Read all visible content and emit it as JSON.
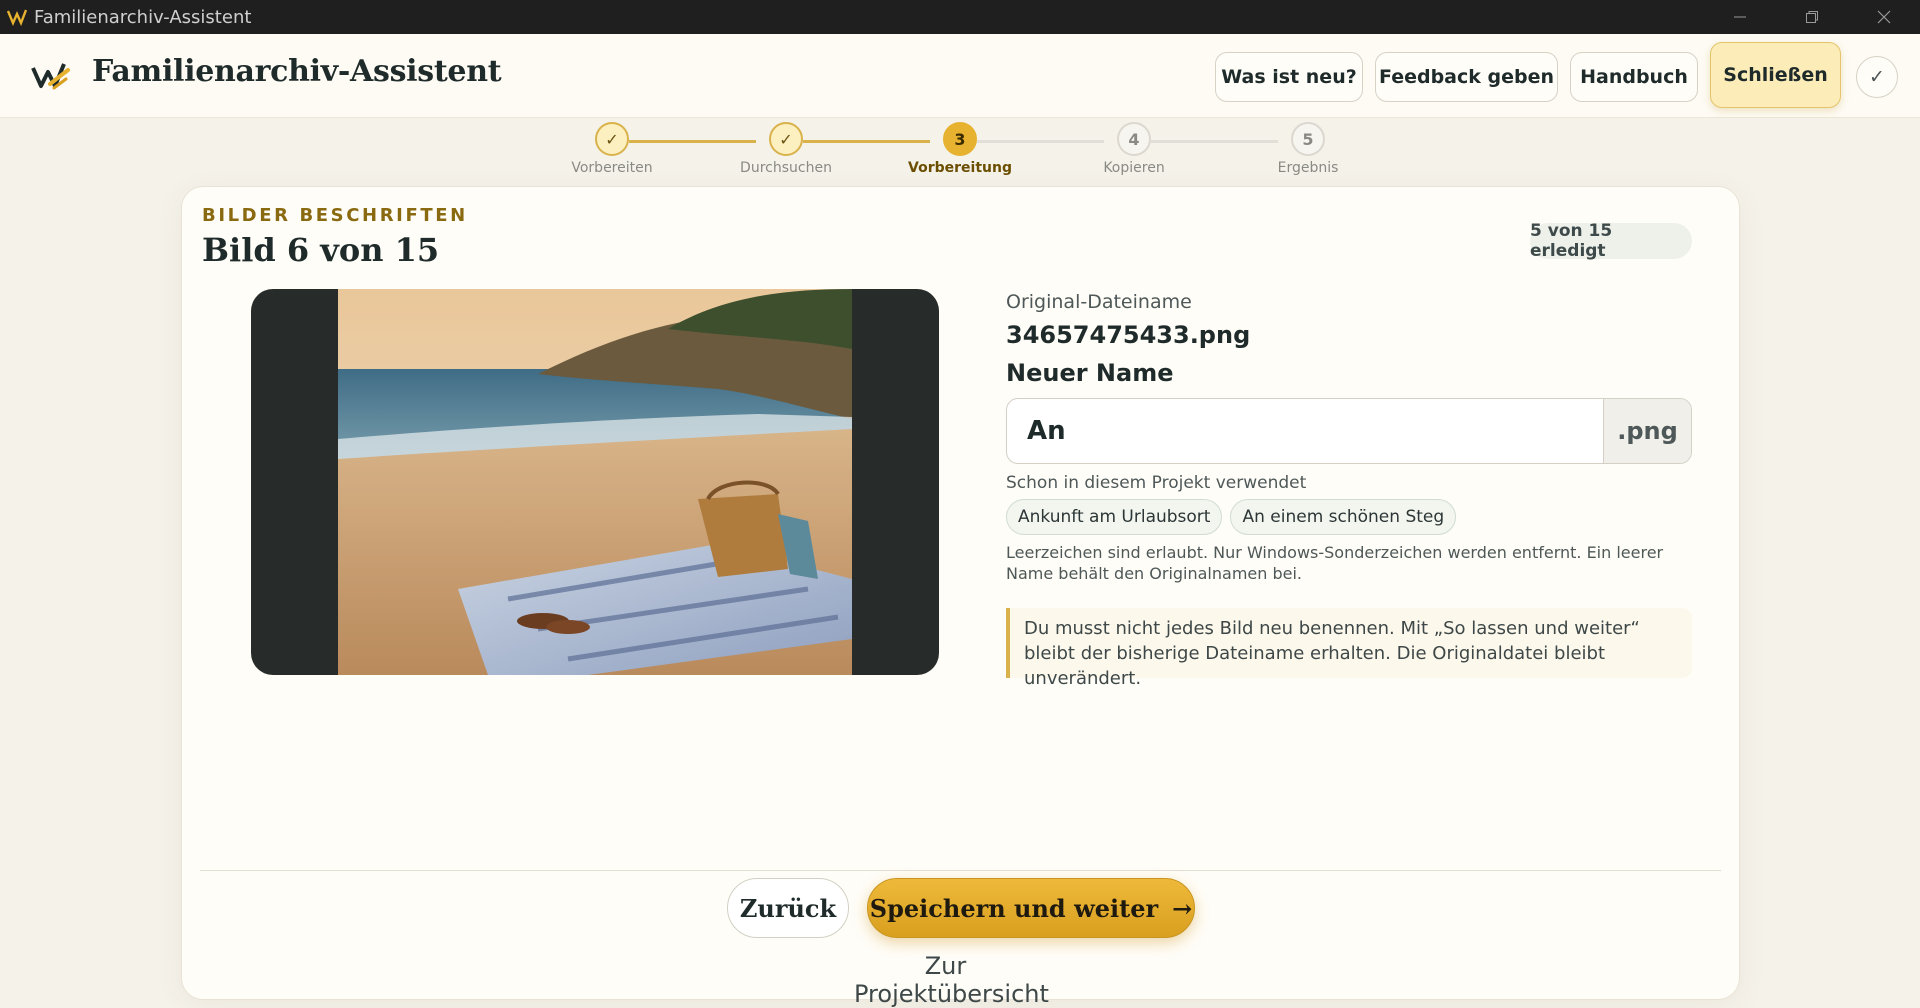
{
  "window": {
    "title": "Familienarchiv-Assistent",
    "icons": {
      "app": "app-logo-icon",
      "minimize": "minimize-icon",
      "restore": "restore-icon",
      "close": "close-icon"
    }
  },
  "header": {
    "title": "Familienarchiv-Assistent",
    "logo_icon": "brand-logo-icon",
    "buttons": {
      "whats_new": "Was ist neu?",
      "feedback": "Feedback geben",
      "manual": "Handbuch",
      "close": "Schließen",
      "check": "✓"
    }
  },
  "stepper": {
    "steps": [
      {
        "number": "1",
        "label": "Vorbereiten",
        "state": "done",
        "mark": "✓"
      },
      {
        "number": "2",
        "label": "Durchsuchen",
        "state": "done",
        "mark": "✓"
      },
      {
        "number": "3",
        "label": "Vorbereitung",
        "state": "active",
        "mark": "3"
      },
      {
        "number": "4",
        "label": "Kopieren",
        "state": "pending",
        "mark": "4"
      },
      {
        "number": "5",
        "label": "Ergebnis",
        "state": "pending",
        "mark": "5"
      }
    ]
  },
  "card": {
    "eyebrow": "BILDER BESCHRIFTEN",
    "title": "Bild 6 von 15",
    "progress_badge": "5 von 15 erledigt",
    "progress": {
      "done": 5,
      "total": 15,
      "current": 6
    }
  },
  "form": {
    "original_label": "Original-Dateiname",
    "original_value": "34657475433.png",
    "new_name_label": "Neuer Name",
    "new_name_value": "An",
    "extension": ".png",
    "used_label": "Schon in diesem Projekt verwendet",
    "used_names": [
      "Ankunft am Urlaubsort",
      "An einem schönen Steg"
    ],
    "hint": "Leerzeichen sind erlaubt. Nur Windows-Sonderzeichen werden entfernt. Ein leerer Name behält den Originalnamen bei.",
    "info": "Du musst nicht jedes Bild neu benennen. Mit „So lassen und weiter“ bleibt der bisherige Dateiname erhalten. Die Originaldatei bleibt unverändert."
  },
  "footer": {
    "back": "Zurück",
    "save": "Speichern und weiter",
    "save_arrow": "→",
    "overview_link": "Zur Projektübersicht"
  },
  "colors": {
    "accent": "#e6b22f",
    "accent_dark": "#8a6a10",
    "background": "#f5f2ea",
    "card": "#fffdf7",
    "titlebar": "#1f1f1f",
    "text": "#1f2a2a"
  }
}
